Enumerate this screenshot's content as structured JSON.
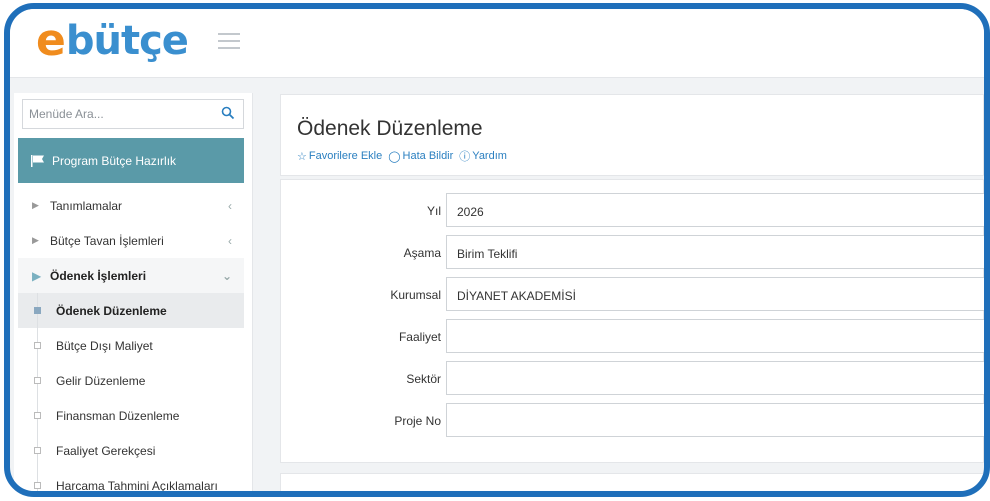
{
  "app": {
    "logo_e": "e",
    "logo_rest": "bütçe",
    "colors": {
      "brand_orange": "#f08c1e",
      "brand_blue": "#3a8fcf",
      "frame": "#1f6fba",
      "section_bg": "#5a9aa8",
      "link": "#2a7fc0"
    }
  },
  "sidebar": {
    "search_placeholder": "Menüde Ara...",
    "search_icon": "search-icon",
    "section_label": "Program Bütçe Hazırlık",
    "section_icon": "flag-icon",
    "items": [
      {
        "label": "Tanımlamalar"
      },
      {
        "label": "Bütçe Tavan İşlemleri"
      },
      {
        "label": "Ödenek İşlemleri"
      }
    ],
    "subitems": [
      {
        "label": "Ödenek Düzenleme"
      },
      {
        "label": "Bütçe Dışı Maliyet"
      },
      {
        "label": "Gelir Düzenleme"
      },
      {
        "label": "Finansman Düzenleme"
      },
      {
        "label": "Faaliyet Gerekçesi"
      },
      {
        "label": "Harcama Tahmini Açıklamaları"
      }
    ]
  },
  "main": {
    "title": "Ödenek Düzenleme",
    "actions": {
      "favorite": "Favorilere Ekle",
      "report": "Hata Bildir",
      "help": "Yardım"
    },
    "form": {
      "year_label": "Yıl",
      "year_value": "2026",
      "stage_label": "Aşama",
      "stage_value": "Birim Teklifi",
      "institution_label": "Kurumsal",
      "institution_value": "DİYANET AKADEMİSİ",
      "activity_label": "Faaliyet",
      "activity_value": "",
      "sector_label": "Sektör",
      "sector_value": "",
      "project_label": "Proje No",
      "project_value": ""
    }
  }
}
